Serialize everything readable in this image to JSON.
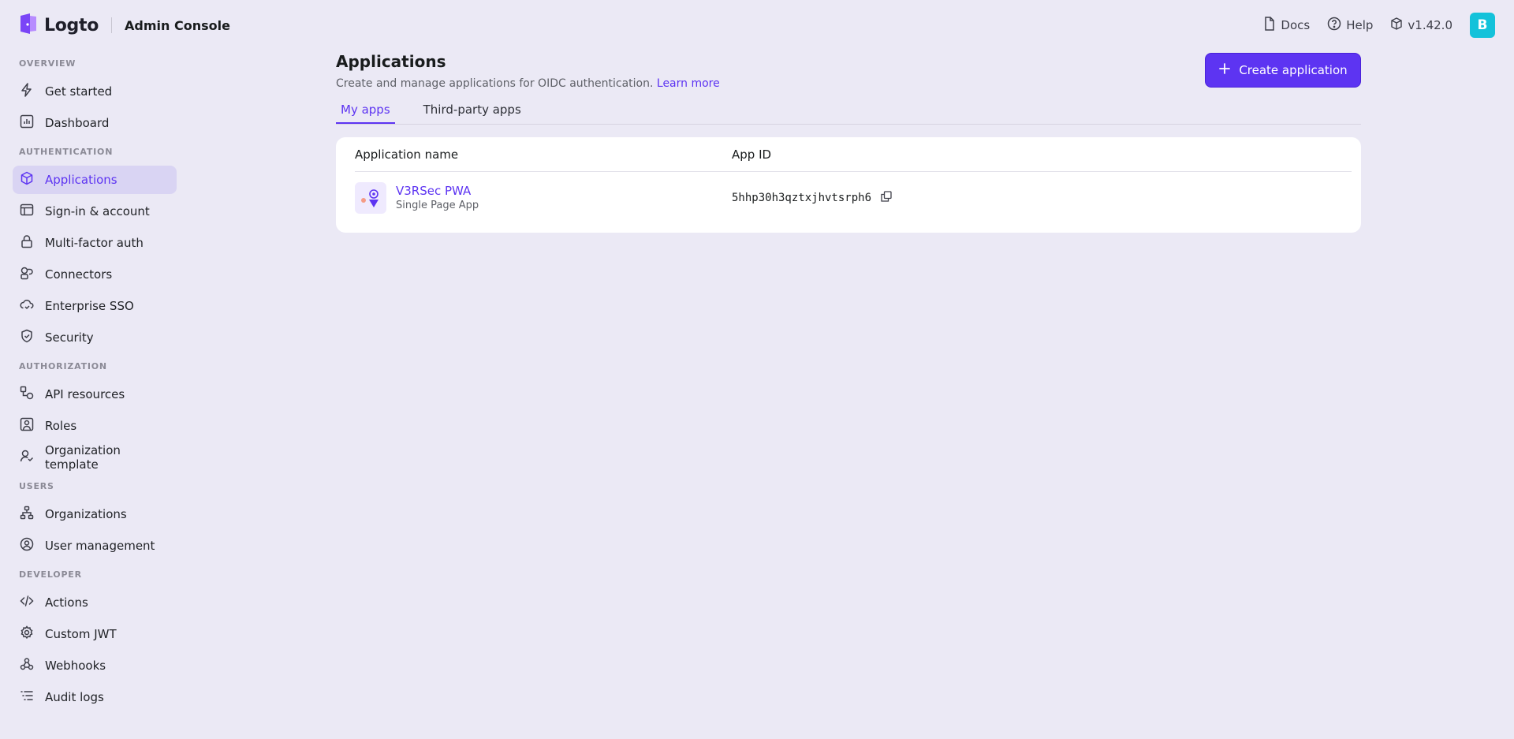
{
  "header": {
    "logo_text": "Logto",
    "console_title": "Admin Console",
    "docs_label": "Docs",
    "help_label": "Help",
    "version": "v1.42.0",
    "avatar_letter": "B",
    "avatar_color": "#14c2da"
  },
  "sidebar": {
    "sections": [
      {
        "title": "OVERVIEW",
        "items": [
          {
            "label": "Get started",
            "icon": "bolt-icon"
          },
          {
            "label": "Dashboard",
            "icon": "chart-icon"
          }
        ]
      },
      {
        "title": "AUTHENTICATION",
        "items": [
          {
            "label": "Applications",
            "icon": "cube-icon",
            "active": true
          },
          {
            "label": "Sign-in & account",
            "icon": "window-icon"
          },
          {
            "label": "Multi-factor auth",
            "icon": "lock-icon"
          },
          {
            "label": "Connectors",
            "icon": "connector-icon"
          },
          {
            "label": "Enterprise SSO",
            "icon": "cloud-icon"
          },
          {
            "label": "Security",
            "icon": "shield-icon"
          }
        ]
      },
      {
        "title": "AUTHORIZATION",
        "items": [
          {
            "label": "API resources",
            "icon": "api-icon"
          },
          {
            "label": "Roles",
            "icon": "role-icon"
          },
          {
            "label": "Organization template",
            "icon": "user-check-icon"
          }
        ]
      },
      {
        "title": "USERS",
        "items": [
          {
            "label": "Organizations",
            "icon": "org-icon"
          },
          {
            "label": "User management",
            "icon": "user-circle-icon"
          }
        ]
      },
      {
        "title": "DEVELOPER",
        "items": [
          {
            "label": "Actions",
            "icon": "code-icon"
          },
          {
            "label": "Custom JWT",
            "icon": "gear-icon"
          },
          {
            "label": "Webhooks",
            "icon": "webhook-icon"
          },
          {
            "label": "Audit logs",
            "icon": "list-icon"
          }
        ]
      }
    ]
  },
  "main": {
    "title": "Applications",
    "subtitle": "Create and manage applications for OIDC authentication.",
    "learn_more": "Learn more",
    "create_button": "Create application",
    "tabs": [
      {
        "label": "My apps",
        "active": true
      },
      {
        "label": "Third-party apps",
        "active": false
      }
    ],
    "table": {
      "columns": [
        "Application name",
        "App ID"
      ],
      "rows": [
        {
          "name": "V3RSec PWA",
          "type": "Single Page App",
          "app_id": "5hhp30h3qztxjhvtsrph6"
        }
      ]
    }
  },
  "colors": {
    "accent": "#5d34f2",
    "background": "#ebe9f5",
    "active_nav": "#d9d4f3"
  }
}
